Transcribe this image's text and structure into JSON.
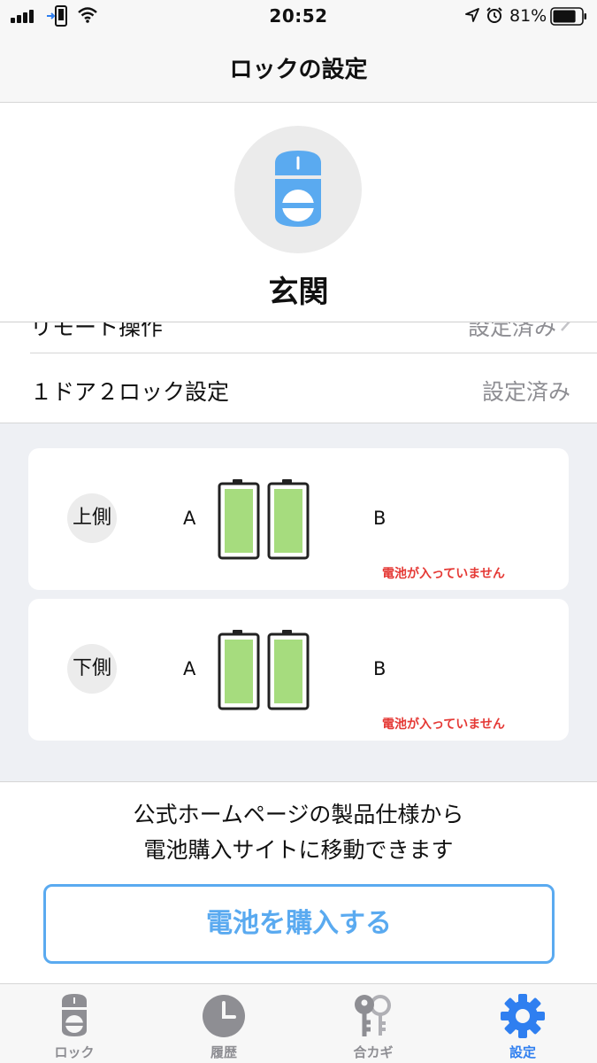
{
  "status_bar": {
    "time": "20:52",
    "battery_percent": "81%",
    "battery_level": 0.81,
    "icons": [
      "signal-icon",
      "phone-icon",
      "wifi-icon",
      "location-icon",
      "alarm-icon",
      "battery-icon"
    ]
  },
  "nav": {
    "title": "ロックの設定"
  },
  "header": {
    "lock_name": "玄関",
    "avatar_icon": "lock-icon"
  },
  "settings_rows": [
    {
      "label": "リモート操作",
      "value": "設定済み"
    },
    {
      "label": "１ドア２ロック設定",
      "value": "設定済み"
    }
  ],
  "battery_cards": [
    {
      "side": "上側",
      "label_a": "A",
      "label_b": "B",
      "warning": "電池が入っていません"
    },
    {
      "side": "下側",
      "label_a": "A",
      "label_b": "B",
      "warning": "電池が入っていません"
    }
  ],
  "info": {
    "line1": "公式ホームページの製品仕様から",
    "line2": "電池購入サイトに移動できます"
  },
  "buy_button": {
    "label": "電池を購入する"
  },
  "tabs": [
    {
      "label": "ロック",
      "icon": "lock-icon",
      "active": false
    },
    {
      "label": "履歴",
      "icon": "clock-icon",
      "active": false
    },
    {
      "label": "合カギ",
      "icon": "keys-icon",
      "active": false
    },
    {
      "label": "設定",
      "icon": "gear-icon",
      "active": true
    }
  ],
  "colors": {
    "accent": "#2f7ff0",
    "button_blue": "#5aaaf0",
    "battery_green": "#a6dc7e",
    "warning_red": "#e53935",
    "section_bg": "#eef0f4"
  }
}
